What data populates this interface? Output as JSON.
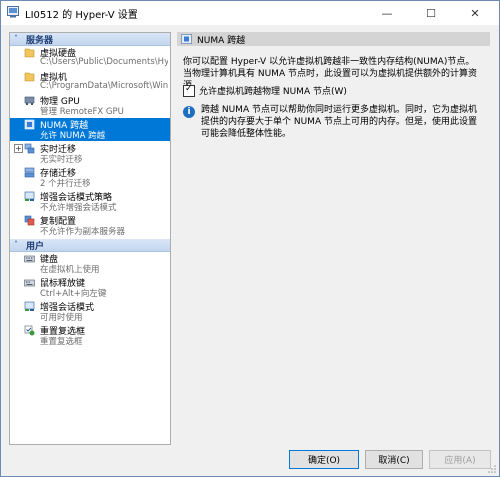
{
  "window": {
    "title": "LI0512 的 Hyper-V 设置",
    "minimize": "—",
    "maximize": "☐",
    "close": "✕"
  },
  "sidebar": {
    "sections": [
      {
        "label": "服务器",
        "chev": "˄"
      },
      {
        "label": "用户",
        "chev": "˄"
      }
    ],
    "server_items": [
      {
        "title": "虚拟硬盘",
        "subtitle": "C:\\Users\\Public\\Documents\\Hyper-...",
        "icon": "virtual-disk-icon"
      },
      {
        "title": "虚拟机",
        "subtitle": "C:\\ProgramData\\Microsoft\\Windo...",
        "icon": "folder-icon"
      },
      {
        "title": "物理 GPU",
        "subtitle": "管理 RemoteFX GPU",
        "icon": "gpu-icon"
      },
      {
        "title": "NUMA 跨越",
        "subtitle": "允许 NUMA 跨越",
        "icon": "numa-icon",
        "selected": true
      },
      {
        "title": "实时迁移",
        "subtitle": "无实时迁移",
        "icon": "live-migration-icon",
        "expand": "+"
      },
      {
        "title": "存储迁移",
        "subtitle": "2 个并行迁移",
        "icon": "storage-migration-icon"
      },
      {
        "title": "增强会话模式策略",
        "subtitle": "不允许增强会话模式",
        "icon": "session-policy-icon"
      },
      {
        "title": "复制配置",
        "subtitle": "不允许作为副本服务器",
        "icon": "replication-icon"
      }
    ],
    "user_items": [
      {
        "title": "键盘",
        "subtitle": "在虚拟机上使用",
        "icon": "keyboard-icon"
      },
      {
        "title": "鼠标释放键",
        "subtitle": "Ctrl+Alt+向左键",
        "icon": "mouse-icon"
      },
      {
        "title": "增强会话模式",
        "subtitle": "可用时使用",
        "icon": "enhanced-session-icon"
      },
      {
        "title": "重置复选框",
        "subtitle": "重置复选框",
        "icon": "reset-checkbox-icon"
      }
    ]
  },
  "panel": {
    "header": "NUMA 跨越",
    "description": "你可以配置 Hyper-V 以允许虚拟机跨越非一致性内存结构(NUMA)节点。当物理计算机具有 NUMA 节点时，此设置可以为虚拟机提供额外的计算资源。",
    "checkbox_label": "允许虚拟机跨越物理 NUMA 节点(W)",
    "checkbox_checked": true,
    "info_text": "跨越 NUMA 节点可以帮助你同时运行更多虚拟机。同时，它为虚拟机提供的内存要大于单个 NUMA 节点上可用的内存。但是，使用此设置可能会降低整体性能。"
  },
  "footer": {
    "ok": "确定(O)",
    "cancel": "取消(C)",
    "apply": "应用(A)"
  },
  "colors": {
    "selection": "#0078d7",
    "section_text": "#1f3f75",
    "info": "#1f6fbf"
  }
}
